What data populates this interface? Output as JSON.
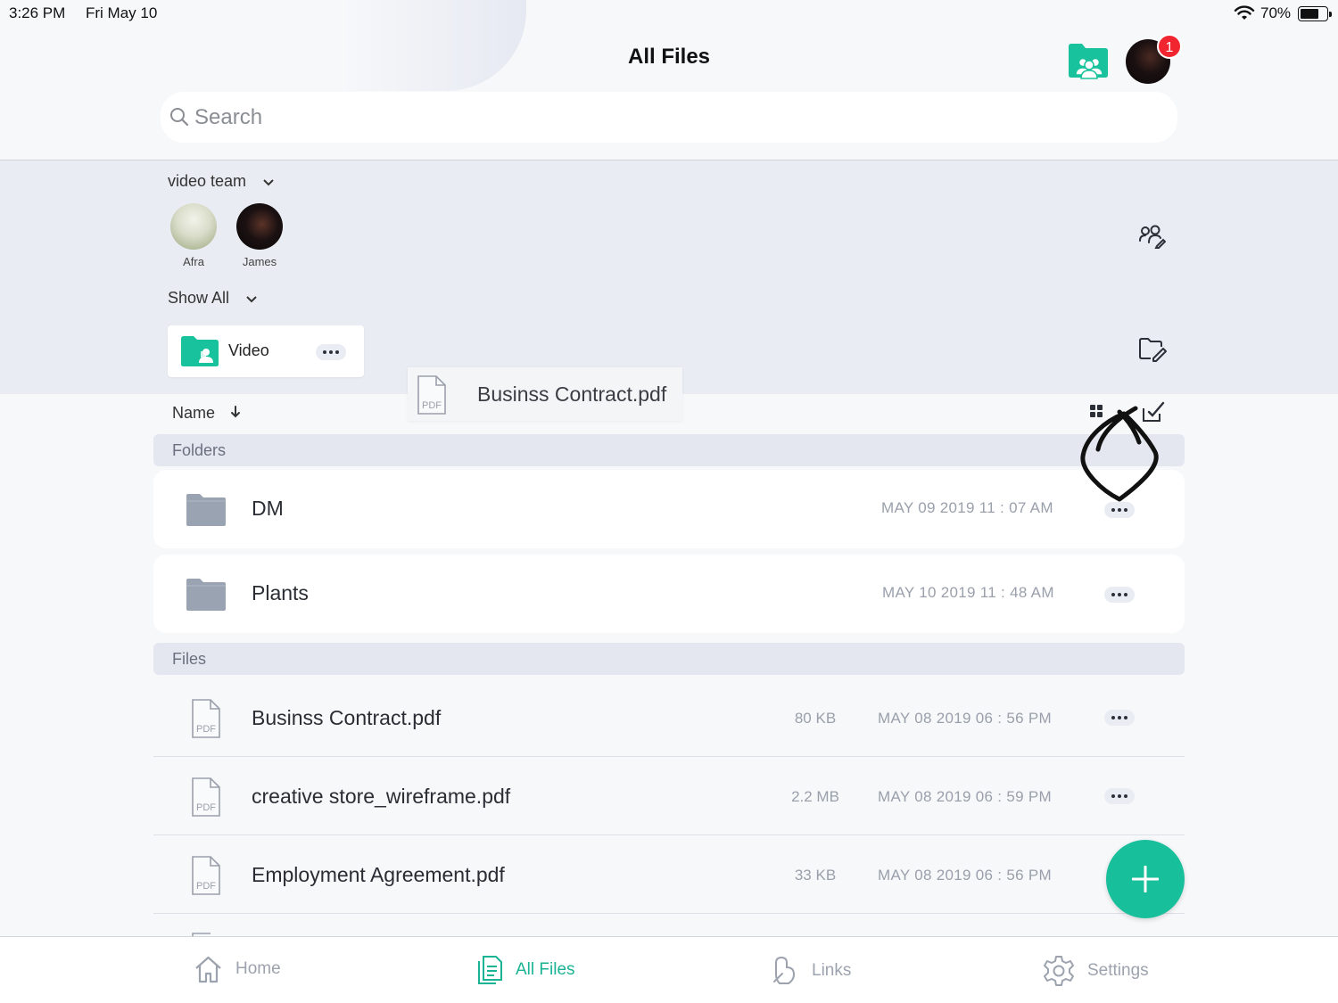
{
  "status_bar": {
    "time": "3:26 PM",
    "date": "Fri May 10",
    "battery_percent": "70%",
    "battery_level": 0.7
  },
  "header": {
    "title": "All Files",
    "notification_count": "1"
  },
  "search": {
    "placeholder": "Search"
  },
  "team": {
    "name": "video team",
    "members": [
      {
        "name": "Afra"
      },
      {
        "name": "James"
      }
    ],
    "show_all_label": "Show All",
    "folders": [
      {
        "name": "Video"
      }
    ]
  },
  "drag_ghost": {
    "file_name": "Businss Contract.pdf"
  },
  "list": {
    "sort_label": "Name",
    "folders_header": "Folders",
    "files_header": "Files",
    "folders": [
      {
        "name": "DM",
        "date": "MAY 09 2019 11 : 07 AM"
      },
      {
        "name": "Plants",
        "date": "MAY 10 2019 11 : 48 AM"
      }
    ],
    "files": [
      {
        "name": "Businss Contract.pdf",
        "size": "80 KB",
        "date": "MAY 08 2019 06 : 56 PM"
      },
      {
        "name": "creative store_wireframe.pdf",
        "size": "2.2 MB",
        "date": "MAY 08 2019 06 : 59 PM"
      },
      {
        "name": "Employment Agreement.pdf",
        "size": "33 KB",
        "date": "MAY 08 2019 06 : 56 PM"
      }
    ],
    "file_icon_label": "PDF"
  },
  "tabbar": {
    "tabs": [
      {
        "label": "Home",
        "icon": "home-icon"
      },
      {
        "label": "All Files",
        "icon": "files-icon",
        "active": true
      },
      {
        "label": "Links",
        "icon": "link-icon"
      },
      {
        "label": "Settings",
        "icon": "gear-icon"
      }
    ]
  },
  "colors": {
    "accent": "#18bf9b",
    "badge": "#f0252f",
    "section_bg": "#e4e7f0",
    "panel_bg": "#e9ecf2"
  }
}
